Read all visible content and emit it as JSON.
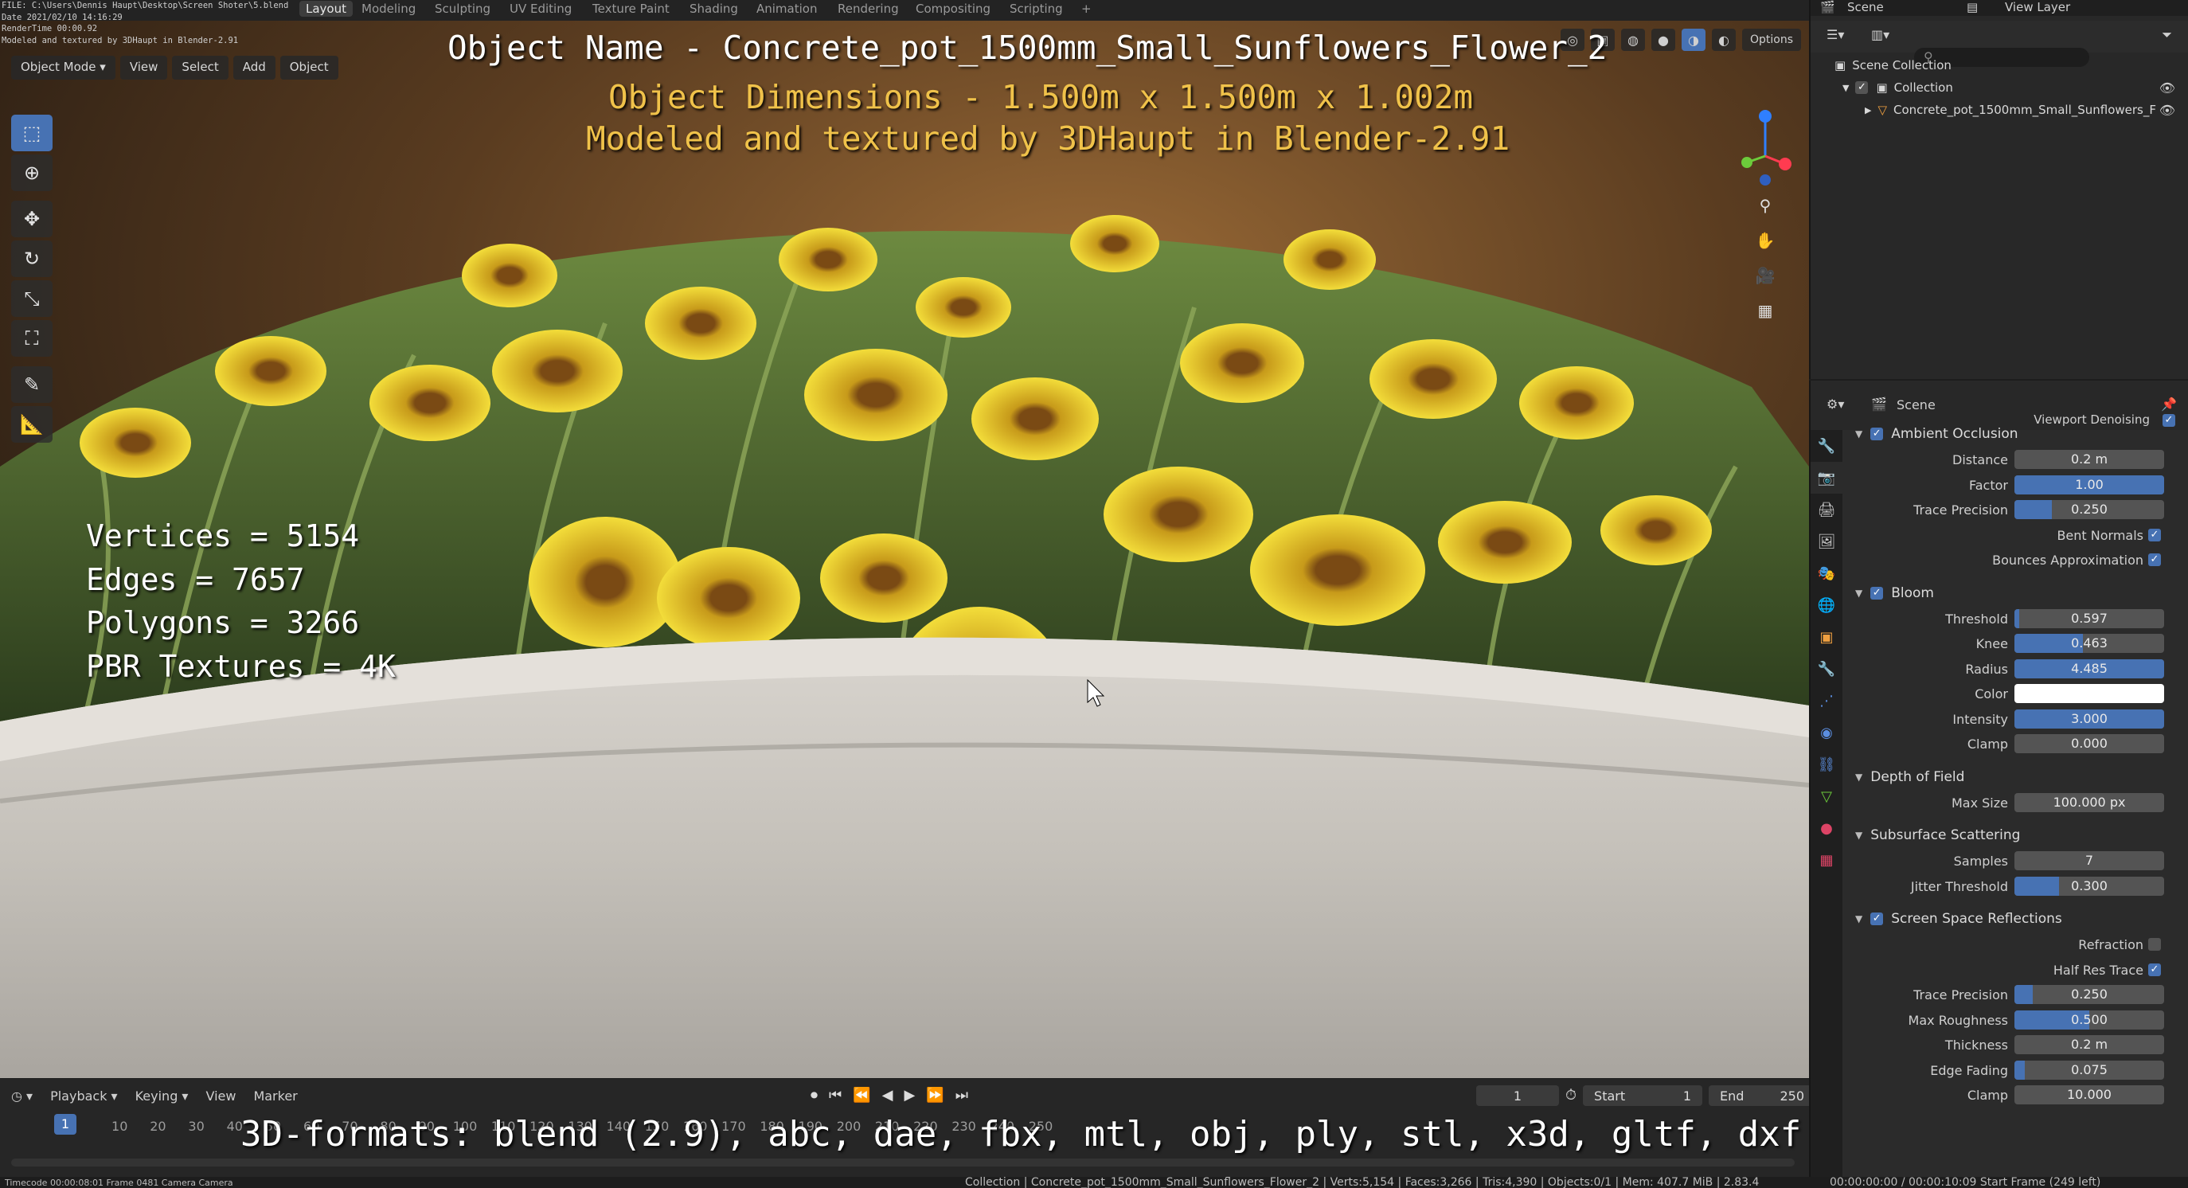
{
  "header": {
    "file_info": [
      "FILE: C:\\Users\\Dennis Haupt\\Desktop\\Screen Shoter\\5.blend",
      "Date 2021/02/10 14:16:29",
      "RenderTime 00:00.92",
      "Modeled and textured by 3DHaupt in Blender-2.91"
    ],
    "tabs": [
      "Layout",
      "Modeling",
      "Sculpting",
      "UV Editing",
      "Texture Paint",
      "Shading",
      "Animation",
      "Rendering",
      "Compositing",
      "Scripting"
    ],
    "active_tab": "Layout",
    "scene_label": "Scene",
    "view_layer_label": "View Layer",
    "options_label": "Options"
  },
  "viewport": {
    "mode": "Object Mode",
    "menus": [
      "View",
      "Select",
      "Add",
      "Object"
    ],
    "tool_icons": [
      "select-box-icon",
      "cursor-icon",
      "move-icon",
      "rotate-icon",
      "scale-icon",
      "transform-icon",
      "annotate-icon",
      "measure-icon"
    ],
    "nav_icons": [
      "zoom-icon",
      "pan-hand-icon",
      "camera-icon",
      "ortho-grid-icon"
    ]
  },
  "overlay": {
    "object_name": "Object Name - Concrete_pot_1500mm_Small_Sunflowers_Flower_2",
    "dimensions": "Object Dimensions -  1.500m x 1.500m x 1.002m",
    "author": "Modeled and textured by 3DHaupt in Blender-2.91",
    "stats": [
      "Vertices = 5154",
      "Edges = 7657",
      "Polygons = 3266",
      "PBR Textures = 4K"
    ],
    "formats": "3D-formats: blend (2.9), abc, dae, fbx, mtl, obj, ply, stl, x3d, gltf, dxf"
  },
  "timeline": {
    "menus": [
      "Playback",
      "Keying",
      "View",
      "Marker"
    ],
    "current_frame": "1",
    "start_label": "Start",
    "start": "1",
    "end_label": "End",
    "end": "250",
    "ruler": [
      "10",
      "20",
      "30",
      "40",
      "50",
      "60",
      "70",
      "80",
      "90",
      "100",
      "110",
      "120",
      "130",
      "140",
      "150",
      "160",
      "170",
      "180",
      "190",
      "200",
      "210",
      "220",
      "230",
      "240",
      "250"
    ],
    "playhead": "1"
  },
  "statusbar": {
    "left": "Timecode 00:00:08:01   Frame 0481   Camera Camera",
    "center": "Collection | Concrete_pot_1500mm_Small_Sunflowers_Flower_2 | Verts:5,154 | Faces:3,266 | Tris:4,390 | Objects:0/1 | Mem: 407.7 MiB | 2.83.4",
    "right": "00:00:00:00 / 00:00:10:09     Start Frame (249 left)"
  },
  "outliner": {
    "root": "Scene Collection",
    "collection": "Collection",
    "object": "Concrete_pot_1500mm_Small_Sunflowers_F"
  },
  "properties": {
    "context": "Scene",
    "viewport_denoising": "Viewport Denoising",
    "panels": [
      {
        "title": "Ambient Occlusion",
        "checkbox": true,
        "rows": [
          {
            "label": "Distance",
            "value": "0.2 m",
            "fill": 0
          },
          {
            "label": "Factor",
            "value": "1.00",
            "fill": 1.0
          },
          {
            "label": "Trace Precision",
            "value": "0.250",
            "fill": 0.25
          },
          {
            "label": "Bent Normals",
            "check": true
          },
          {
            "label": "Bounces Approximation",
            "check": true
          }
        ]
      },
      {
        "title": "Bloom",
        "checkbox": true,
        "rows": [
          {
            "label": "Threshold",
            "value": "0.597",
            "fill": 0.03
          },
          {
            "label": "Knee",
            "value": "0.463",
            "fill": 0.46
          },
          {
            "label": "Radius",
            "value": "4.485",
            "fill": 1.0
          },
          {
            "label": "Color",
            "color": "#ffffff"
          },
          {
            "label": "Intensity",
            "value": "3.000",
            "fill": 1.0
          },
          {
            "label": "Clamp",
            "value": "0.000",
            "fill": 0
          }
        ]
      },
      {
        "title": "Depth of Field",
        "checkbox": null,
        "rows": [
          {
            "label": "Max Size",
            "value": "100.000 px",
            "fill": 0
          }
        ]
      },
      {
        "title": "Subsurface Scattering",
        "checkbox": null,
        "rows": [
          {
            "label": "Samples",
            "value": "7",
            "fill": 0
          },
          {
            "label": "Jitter Threshold",
            "value": "0.300",
            "fill": 0.3
          }
        ]
      },
      {
        "title": "Screen Space Reflections",
        "checkbox": true,
        "rows": [
          {
            "label": "Refraction",
            "check": false
          },
          {
            "label": "Half Res Trace",
            "check": true
          },
          {
            "label": "Trace Precision",
            "value": "0.250",
            "fill": 0.12
          },
          {
            "label": "Max Roughness",
            "value": "0.500",
            "fill": 0.5
          },
          {
            "label": "Thickness",
            "value": "0.2 m",
            "fill": 0
          },
          {
            "label": "Edge Fading",
            "value": "0.075",
            "fill": 0.07
          },
          {
            "label": "Clamp",
            "value": "10.000",
            "fill": 0
          }
        ]
      }
    ]
  },
  "colors": {
    "accent": "#4772b3",
    "overlay_gold": "#f0c24a",
    "petal": "#e8c822",
    "pot": "#c8c4be"
  }
}
